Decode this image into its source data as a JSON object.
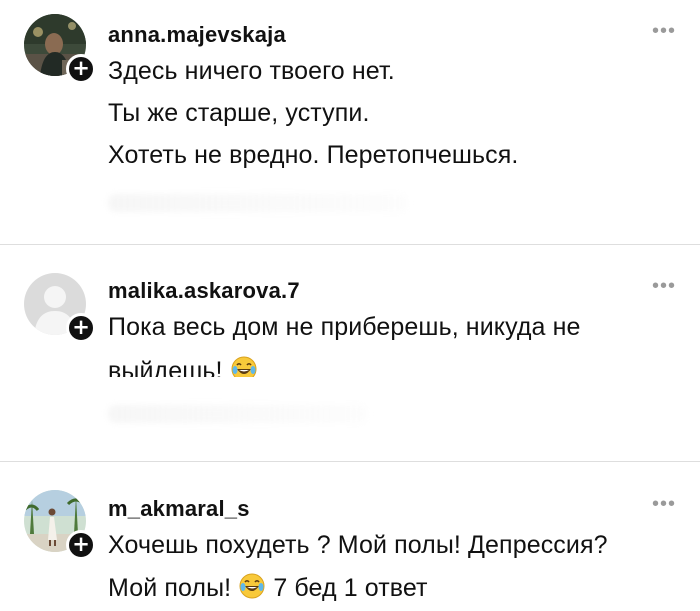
{
  "comments": [
    {
      "username": "anna.majevskaja",
      "lines": [
        "Здесь ничего твоего нет.",
        "Ты же старше, уступи.",
        "Хотеть не вредно. Перетопчешься."
      ],
      "more_icon": "more-horizontal-icon",
      "badge_icon": "plus-icon"
    },
    {
      "username": "malika.askarova.7",
      "lines": [
        "Пока весь дом не приберешь, никуда не",
        "выйдешь!"
      ],
      "emoji": "tears-of-joy-emoji",
      "more_icon": "more-horizontal-icon",
      "badge_icon": "plus-icon"
    },
    {
      "username": "m_akmaral_s",
      "lines": [
        "Хочешь похудеть ? Мой полы! Депрессия?",
        "Мой полы!",
        "7 бед 1 ответ"
      ],
      "emoji": "tears-of-joy-emoji",
      "more_icon": "more-horizontal-icon",
      "badge_icon": "plus-icon"
    }
  ],
  "ui": {
    "more_glyph": "•••",
    "plus_glyph": "+"
  },
  "colors": {
    "text": "#111111",
    "muted": "#9a9a9a",
    "divider": "#dedede",
    "badge": "#111111"
  }
}
